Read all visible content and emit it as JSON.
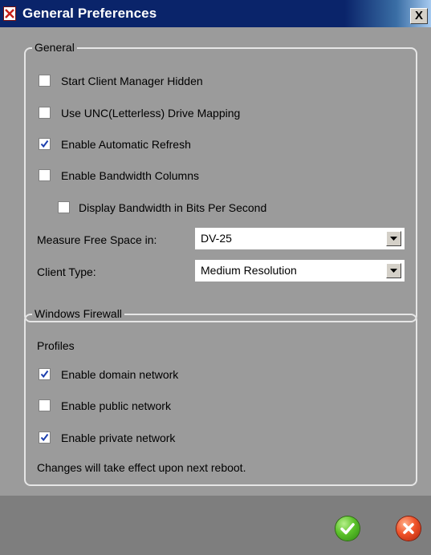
{
  "window": {
    "title": "General Preferences",
    "close_label": "X"
  },
  "general": {
    "legend": "General",
    "options": [
      {
        "label": "Start Client Manager Hidden",
        "checked": false
      },
      {
        "label": "Use UNC(Letterless) Drive Mapping",
        "checked": false
      },
      {
        "label": "Enable Automatic Refresh",
        "checked": true
      },
      {
        "label": "Enable Bandwidth Columns",
        "checked": false
      },
      {
        "label": "Display Bandwidth in Bits Per Second",
        "checked": false
      }
    ],
    "measure_free_space": {
      "label": "Measure Free Space in:",
      "value": "DV-25"
    },
    "client_type": {
      "label": "Client Type:",
      "value": "Medium Resolution"
    }
  },
  "firewall": {
    "legend": "Windows Firewall",
    "profiles_label": "Profiles",
    "options": [
      {
        "label": "Enable domain network",
        "checked": true
      },
      {
        "label": "Enable public network",
        "checked": false
      },
      {
        "label": "Enable private network",
        "checked": true
      }
    ],
    "note": "Changes will take effect upon next reboot."
  },
  "footer": {
    "ok_icon": "green-checkmark-icon",
    "cancel_icon": "red-x-icon"
  },
  "colors": {
    "titlebar": "#0a246a",
    "body": "#9b9b9b",
    "footer": "#7e7e7e"
  }
}
